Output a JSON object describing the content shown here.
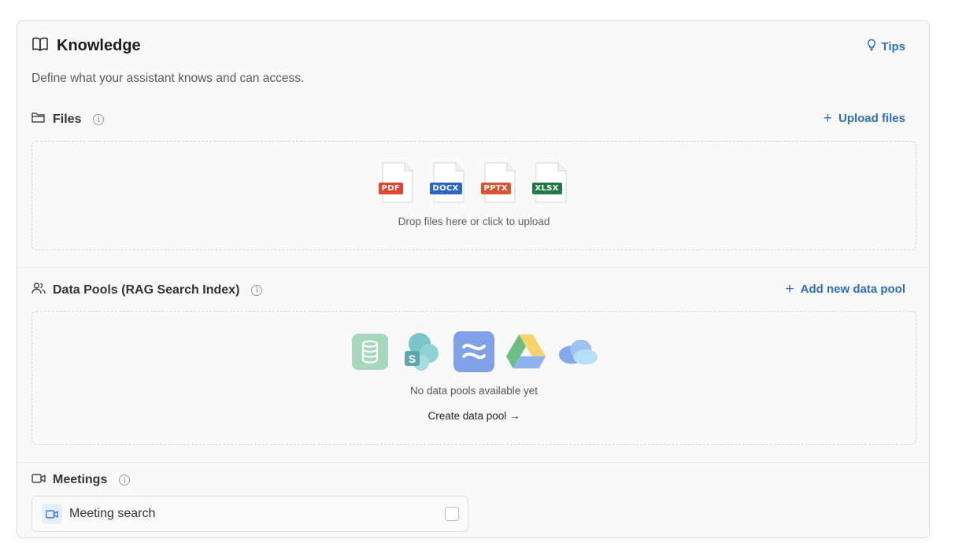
{
  "header": {
    "title": "Knowledge",
    "tips_label": "Tips",
    "subtitle": "Define what your assistant knows and can access."
  },
  "files": {
    "label": "Files",
    "info": "i",
    "action_label": "Upload files",
    "file_types": [
      {
        "label": "PDF",
        "color": "#e5432e"
      },
      {
        "label": "DOCX",
        "color": "#2b66c4"
      },
      {
        "label": "PPTX",
        "color": "#d9532f"
      },
      {
        "label": "XLSX",
        "color": "#1f7a45"
      }
    ],
    "drop_text": "Drop files here or click to upload"
  },
  "data_pools": {
    "label": "Data Pools (RAG Search Index)",
    "info": "i",
    "action_label": "Add new data pool",
    "sources": [
      "database-icon",
      "sharepoint-icon",
      "confluence-icon",
      "google-drive-icon",
      "onedrive-icon"
    ],
    "empty_text": "No data pools available yet",
    "create_link": "Create data pool →"
  },
  "meetings": {
    "label": "Meetings",
    "info": "i",
    "item_label": "Meeting search",
    "checked": false
  },
  "colors": {
    "accent": "#2f6fbf"
  }
}
